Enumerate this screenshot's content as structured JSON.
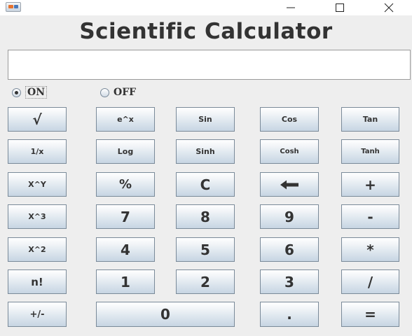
{
  "window": {
    "minimize": "—",
    "maximize": "☐",
    "close": "✕"
  },
  "heading": "Scientific Calculator",
  "display": {
    "value": ""
  },
  "power": {
    "on_label": "ON",
    "off_label": "OFF",
    "selected": "ON"
  },
  "buttons": {
    "sqrt": "√",
    "exp": "e^x",
    "sin": "Sin",
    "cos": "Cos",
    "tan": "Tan",
    "reciprocal": "1/x",
    "log": "Log",
    "sinh": "Sinh",
    "cosh": "Cosh",
    "tanh": "Tanh",
    "power_xy": "X^Y",
    "percent": "%",
    "clear": "C",
    "backspace": "🡐",
    "plus": "+",
    "cube": "X^3",
    "seven": "7",
    "eight": "8",
    "nine": "9",
    "minus": "-",
    "square": "X^2",
    "four": "4",
    "five": "5",
    "six": "6",
    "multiply": "*",
    "factorial": "n!",
    "one": "1",
    "two": "2",
    "three": "3",
    "divide": "/",
    "negate": "+/-",
    "zero": "0",
    "decimal": ".",
    "equals": "="
  },
  "colors": {
    "background": "#eeeeee",
    "heading": "#333333",
    "button_border": "#7a8a99"
  }
}
